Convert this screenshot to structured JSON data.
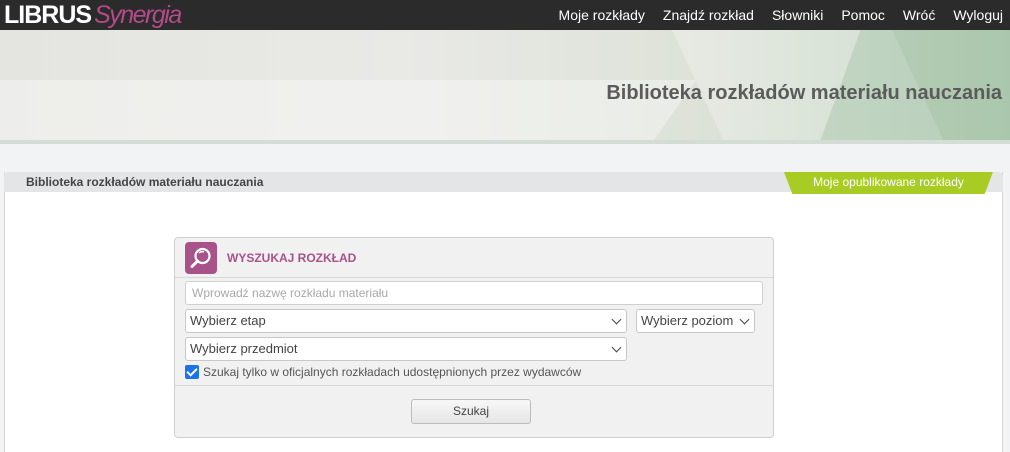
{
  "logo": {
    "part1": "LIBRUS",
    "part2": "Synergia"
  },
  "nav": {
    "items": [
      {
        "label": "Moje rozkłady"
      },
      {
        "label": "Znajdź rozkład"
      },
      {
        "label": "Słowniki"
      },
      {
        "label": "Pomoc"
      },
      {
        "label": "Wróć"
      },
      {
        "label": "Wyloguj"
      }
    ]
  },
  "banner": {
    "title": "Biblioteka rozkładów materiału nauczania"
  },
  "panel": {
    "title": "Biblioteka rozkładów materiału nauczania",
    "tab_label": "Moje opublikowane rozkłady"
  },
  "search": {
    "title": "WYSZUKAJ ROZKŁAD",
    "name_placeholder": "Wprowadź nazwę rozkładu materiału",
    "name_value": "",
    "etap": {
      "selected": "Wybierz etap"
    },
    "poziom": {
      "selected": "Wybierz poziom"
    },
    "przedmiot": {
      "selected": "Wybierz przedmiot"
    },
    "official_only": {
      "label": "Szukaj tylko w oficjalnych rozkładach udostępnionych przez wydawców",
      "checked": true
    },
    "submit_label": "Szukaj"
  },
  "colors": {
    "brand_accent": "#a8528a",
    "topbar": "#2b2b2b",
    "tab_green": "#a8cc23",
    "checkbox": "#1a73e8"
  }
}
